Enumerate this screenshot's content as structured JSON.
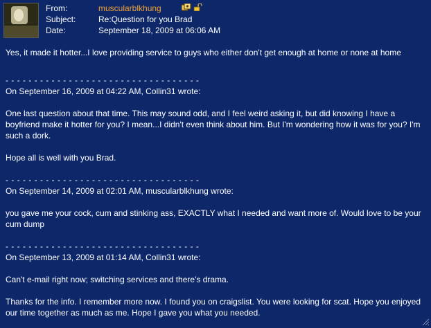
{
  "header": {
    "from_label": "From:",
    "from_value": "muscularblkhung",
    "subject_label": "Subject:",
    "subject_value": "Re:Question for you Brad",
    "date_label": "Date:",
    "date_value": "September 18, 2009 at 06:06 AM",
    "icons": [
      "photos-icon",
      "unlock-icon"
    ],
    "accent_color": "#f6a32b"
  },
  "messages": {
    "reply": "Yes, it made it hotter...I love providing service to guys who either don't get enough at home or none at home",
    "separator": "- - - - - - - - - - - - - - - - - - - - - - - - - - - - - - - - - -",
    "q1_header": "On September 16, 2009 at 04:22 AM, Collin31 wrote:",
    "q1_body": "One last question about that time. This may sound odd, and I feel weird asking it, but did knowing I have a boyfriend make it hotter for you? I mean...I didn't even think about him. But I'm wondering how it was for you? I'm such a dork.",
    "q1_closing": "Hope all is well with you Brad.",
    "q2_header": "On September 14, 2009 at 02:01 AM, muscularblkhung wrote:",
    "q2_body": "you gave me your cock, cum and stinking ass, EXACTLY what I needed and want more of. Would love to be your cum dump",
    "q3_header": "On September 13, 2009 at 01:14 AM, Collin31 wrote:",
    "q3_body": "Can't e-mail right now; switching services and there's drama.",
    "q3_body2": "Thanks for the info. I remember more now. I found you on craigslist. You were looking for scat. Hope you enjoyed our time together as much as me. Hope I gave you what you needed."
  }
}
